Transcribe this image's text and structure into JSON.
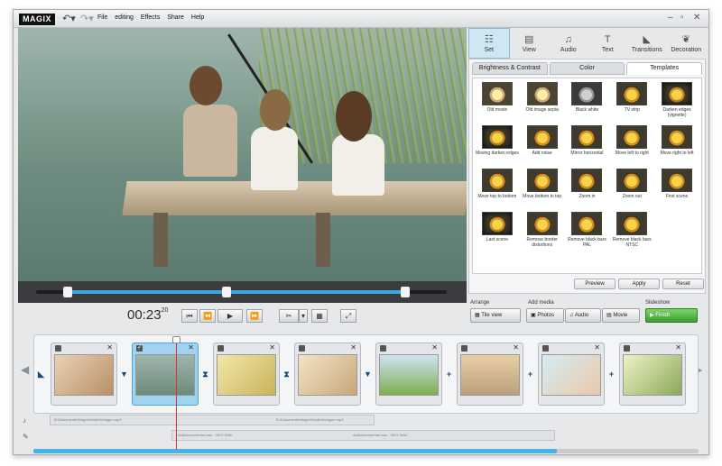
{
  "app": {
    "logo": "MAGIX"
  },
  "menu": [
    "File",
    "editing",
    "Effects",
    "Share",
    "Help"
  ],
  "window_controls": {
    "close": "✕"
  },
  "right_tabs": [
    {
      "label": "Set",
      "icon": "sliders-icon"
    },
    {
      "label": "View",
      "icon": "book-icon"
    },
    {
      "label": "Audio",
      "icon": "music-note-icon"
    },
    {
      "label": "Text",
      "icon": "text-icon"
    },
    {
      "label": "Transitions",
      "icon": "transitions-icon"
    },
    {
      "label": "Decoration",
      "icon": "decoration-icon"
    }
  ],
  "sub_tabs": [
    "Brightness & Contrast",
    "Color",
    "Templates"
  ],
  "templates": [
    "Old movie",
    "Old image sepia",
    "Black white",
    "TV strip",
    "Darken edges (vignette)",
    "Moving darken edges",
    "Add noise",
    "Mirror horizontal",
    "Move left to right",
    "Move right to left",
    "Move top to bottom",
    "Move bottom to top",
    "Zoom in",
    "Zoom out",
    "First scene",
    "Last scene",
    "Remove border distortions",
    "Remove black bars PAL",
    "Remove black bars NTSC"
  ],
  "panel_buttons": {
    "preview": "Preview",
    "apply": "Apply",
    "reset": "Reset"
  },
  "timecode": {
    "main": "00:23",
    "frames": "20"
  },
  "sections": {
    "arrange": "Arrange",
    "add_media": "Add media",
    "slideshow": "Slideshow"
  },
  "buttons": {
    "tile_view": "Tile view",
    "photos": "Photos",
    "audio": "Audio",
    "movie": "Movie",
    "finish": "Finish"
  },
  "audio_tracks": {
    "track1": "B:\\Dokumente\\Magix\\Musik\\Vorlagen.mp3",
    "track1b": "B:\\Dokumente\\Magix\\Musik\\Vorlagen.mp3",
    "track2": "Audiokommentar.wav · 0001.WAV",
    "track2b": "Audiokommentar.wav · 0001.WAV"
  },
  "colors": {
    "accent": "#39a9e0",
    "finish": "#4caf3a",
    "playhead": "#e0302a"
  }
}
